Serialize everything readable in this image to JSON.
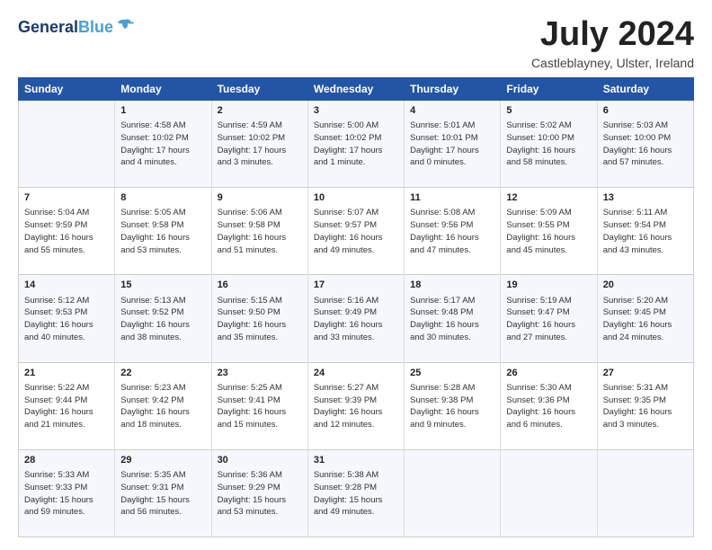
{
  "logo": {
    "line1": "General",
    "line2": "Blue"
  },
  "title": "July 2024",
  "location": "Castleblayney, Ulster, Ireland",
  "headers": [
    "Sunday",
    "Monday",
    "Tuesday",
    "Wednesday",
    "Thursday",
    "Friday",
    "Saturday"
  ],
  "weeks": [
    [
      {
        "day": "",
        "content": ""
      },
      {
        "day": "1",
        "content": "Sunrise: 4:58 AM\nSunset: 10:02 PM\nDaylight: 17 hours\nand 4 minutes."
      },
      {
        "day": "2",
        "content": "Sunrise: 4:59 AM\nSunset: 10:02 PM\nDaylight: 17 hours\nand 3 minutes."
      },
      {
        "day": "3",
        "content": "Sunrise: 5:00 AM\nSunset: 10:02 PM\nDaylight: 17 hours\nand 1 minute."
      },
      {
        "day": "4",
        "content": "Sunrise: 5:01 AM\nSunset: 10:01 PM\nDaylight: 17 hours\nand 0 minutes."
      },
      {
        "day": "5",
        "content": "Sunrise: 5:02 AM\nSunset: 10:00 PM\nDaylight: 16 hours\nand 58 minutes."
      },
      {
        "day": "6",
        "content": "Sunrise: 5:03 AM\nSunset: 10:00 PM\nDaylight: 16 hours\nand 57 minutes."
      }
    ],
    [
      {
        "day": "7",
        "content": "Sunrise: 5:04 AM\nSunset: 9:59 PM\nDaylight: 16 hours\nand 55 minutes."
      },
      {
        "day": "8",
        "content": "Sunrise: 5:05 AM\nSunset: 9:58 PM\nDaylight: 16 hours\nand 53 minutes."
      },
      {
        "day": "9",
        "content": "Sunrise: 5:06 AM\nSunset: 9:58 PM\nDaylight: 16 hours\nand 51 minutes."
      },
      {
        "day": "10",
        "content": "Sunrise: 5:07 AM\nSunset: 9:57 PM\nDaylight: 16 hours\nand 49 minutes."
      },
      {
        "day": "11",
        "content": "Sunrise: 5:08 AM\nSunset: 9:56 PM\nDaylight: 16 hours\nand 47 minutes."
      },
      {
        "day": "12",
        "content": "Sunrise: 5:09 AM\nSunset: 9:55 PM\nDaylight: 16 hours\nand 45 minutes."
      },
      {
        "day": "13",
        "content": "Sunrise: 5:11 AM\nSunset: 9:54 PM\nDaylight: 16 hours\nand 43 minutes."
      }
    ],
    [
      {
        "day": "14",
        "content": "Sunrise: 5:12 AM\nSunset: 9:53 PM\nDaylight: 16 hours\nand 40 minutes."
      },
      {
        "day": "15",
        "content": "Sunrise: 5:13 AM\nSunset: 9:52 PM\nDaylight: 16 hours\nand 38 minutes."
      },
      {
        "day": "16",
        "content": "Sunrise: 5:15 AM\nSunset: 9:50 PM\nDaylight: 16 hours\nand 35 minutes."
      },
      {
        "day": "17",
        "content": "Sunrise: 5:16 AM\nSunset: 9:49 PM\nDaylight: 16 hours\nand 33 minutes."
      },
      {
        "day": "18",
        "content": "Sunrise: 5:17 AM\nSunset: 9:48 PM\nDaylight: 16 hours\nand 30 minutes."
      },
      {
        "day": "19",
        "content": "Sunrise: 5:19 AM\nSunset: 9:47 PM\nDaylight: 16 hours\nand 27 minutes."
      },
      {
        "day": "20",
        "content": "Sunrise: 5:20 AM\nSunset: 9:45 PM\nDaylight: 16 hours\nand 24 minutes."
      }
    ],
    [
      {
        "day": "21",
        "content": "Sunrise: 5:22 AM\nSunset: 9:44 PM\nDaylight: 16 hours\nand 21 minutes."
      },
      {
        "day": "22",
        "content": "Sunrise: 5:23 AM\nSunset: 9:42 PM\nDaylight: 16 hours\nand 18 minutes."
      },
      {
        "day": "23",
        "content": "Sunrise: 5:25 AM\nSunset: 9:41 PM\nDaylight: 16 hours\nand 15 minutes."
      },
      {
        "day": "24",
        "content": "Sunrise: 5:27 AM\nSunset: 9:39 PM\nDaylight: 16 hours\nand 12 minutes."
      },
      {
        "day": "25",
        "content": "Sunrise: 5:28 AM\nSunset: 9:38 PM\nDaylight: 16 hours\nand 9 minutes."
      },
      {
        "day": "26",
        "content": "Sunrise: 5:30 AM\nSunset: 9:36 PM\nDaylight: 16 hours\nand 6 minutes."
      },
      {
        "day": "27",
        "content": "Sunrise: 5:31 AM\nSunset: 9:35 PM\nDaylight: 16 hours\nand 3 minutes."
      }
    ],
    [
      {
        "day": "28",
        "content": "Sunrise: 5:33 AM\nSunset: 9:33 PM\nDaylight: 15 hours\nand 59 minutes."
      },
      {
        "day": "29",
        "content": "Sunrise: 5:35 AM\nSunset: 9:31 PM\nDaylight: 15 hours\nand 56 minutes."
      },
      {
        "day": "30",
        "content": "Sunrise: 5:36 AM\nSunset: 9:29 PM\nDaylight: 15 hours\nand 53 minutes."
      },
      {
        "day": "31",
        "content": "Sunrise: 5:38 AM\nSunset: 9:28 PM\nDaylight: 15 hours\nand 49 minutes."
      },
      {
        "day": "",
        "content": ""
      },
      {
        "day": "",
        "content": ""
      },
      {
        "day": "",
        "content": ""
      }
    ]
  ]
}
